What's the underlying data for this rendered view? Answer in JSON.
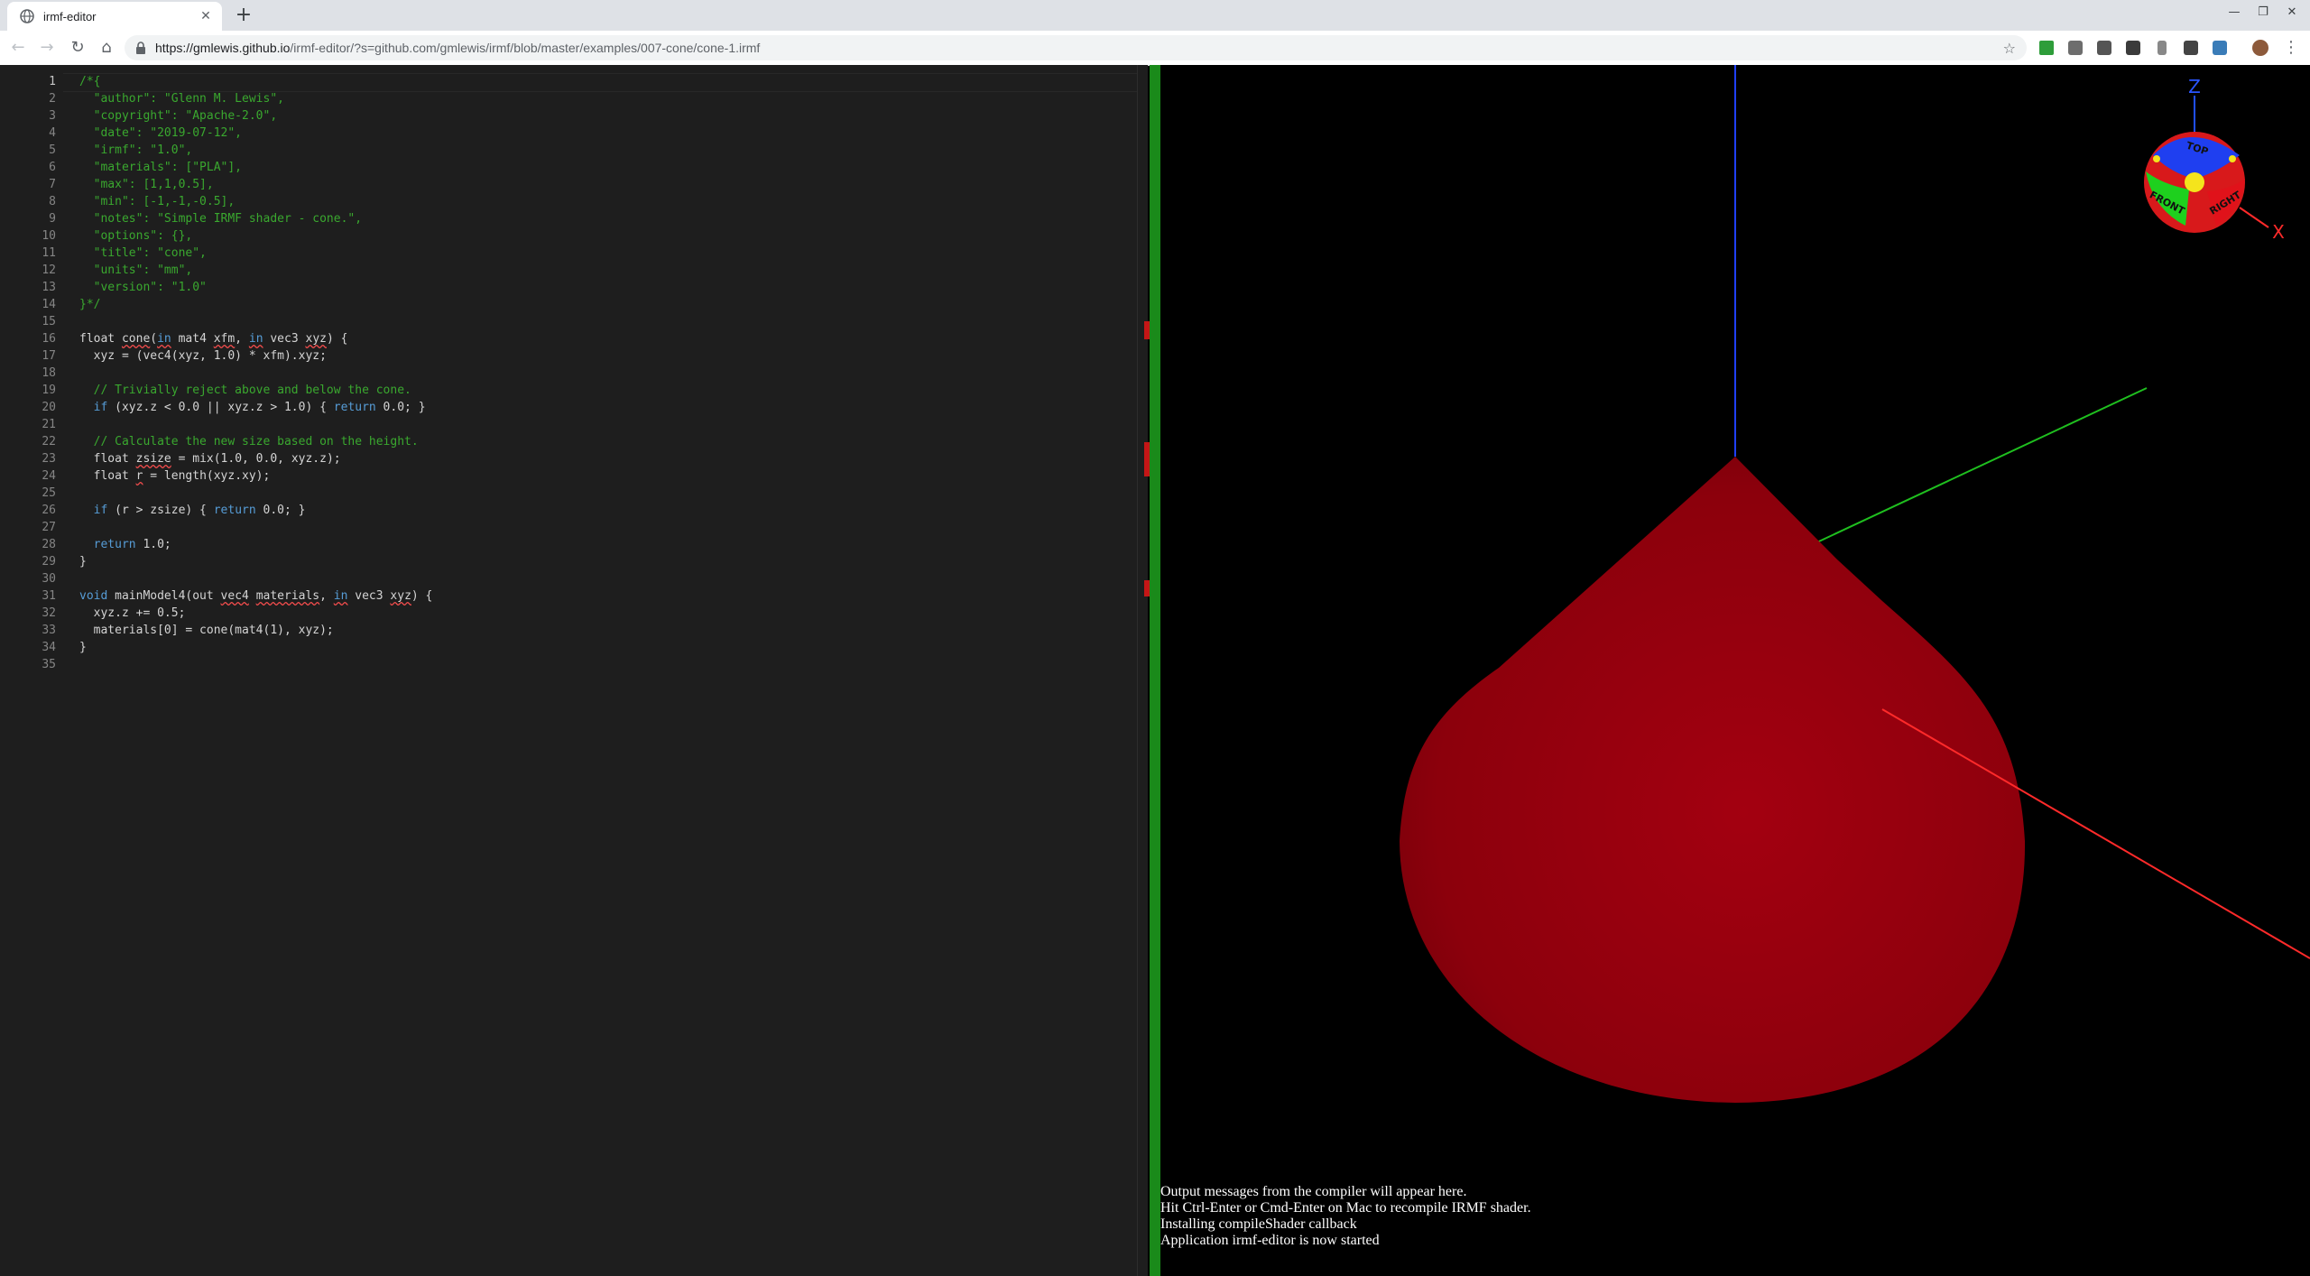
{
  "browser": {
    "tab_title": "irmf-editor",
    "url_host": "https://gmlewis.github.io",
    "url_rest": "/irmf-editor/?s=github.com/gmlewis/irmf/blob/master/examples/007-cone/cone-1.irmf"
  },
  "editor": {
    "lines": [
      {
        "n": "1",
        "html": "<span class=\"c-com\">/*{</span>"
      },
      {
        "n": "2",
        "html": "<span class=\"c-com\">  \"author\": \"Glenn M. Lewis\",</span>"
      },
      {
        "n": "3",
        "html": "<span class=\"c-com\">  \"copyright\": \"Apache-2.0\",</span>"
      },
      {
        "n": "4",
        "html": "<span class=\"c-com\">  \"date\": \"2019-07-12\",</span>"
      },
      {
        "n": "5",
        "html": "<span class=\"c-com\">  \"irmf\": \"1.0\",</span>"
      },
      {
        "n": "6",
        "html": "<span class=\"c-com\">  \"materials\": [\"PLA\"],</span>"
      },
      {
        "n": "7",
        "html": "<span class=\"c-com\">  \"max\": [1,1,0.5],</span>"
      },
      {
        "n": "8",
        "html": "<span class=\"c-com\">  \"min\": [-1,-1,-0.5],</span>"
      },
      {
        "n": "9",
        "html": "<span class=\"c-com\">  \"notes\": \"Simple IRMF shader - cone.\",</span>"
      },
      {
        "n": "10",
        "html": "<span class=\"c-com\">  \"options\": {},</span>"
      },
      {
        "n": "11",
        "html": "<span class=\"c-com\">  \"title\": \"cone\",</span>"
      },
      {
        "n": "12",
        "html": "<span class=\"c-com\">  \"units\": \"mm\",</span>"
      },
      {
        "n": "13",
        "html": "<span class=\"c-com\">  \"version\": \"1.0\"</span>"
      },
      {
        "n": "14",
        "html": "<span class=\"c-com\">}*/</span>"
      },
      {
        "n": "15",
        "html": ""
      },
      {
        "n": "16",
        "html": "float <span class=\"sq\">cone</span>(<span class=\"c-kw sq\">in</span> mat4 <span class=\"sq\">xfm</span>, <span class=\"c-kw sq\">in</span> vec3 <span class=\"sq\">xyz</span>) {"
      },
      {
        "n": "17",
        "html": "  xyz = (vec4(xyz, 1.0) * xfm).xyz;"
      },
      {
        "n": "18",
        "html": ""
      },
      {
        "n": "19",
        "html": "<span class=\"c-com\">  // Trivially reject above and below the cone.</span>"
      },
      {
        "n": "20",
        "html": "  <span class=\"c-kw\">if</span> (xyz.z &lt; 0.0 || xyz.z &gt; 1.0) { <span class=\"c-kw\">return</span> 0.0; }"
      },
      {
        "n": "21",
        "html": ""
      },
      {
        "n": "22",
        "html": "<span class=\"c-com\">  // Calculate the new size based on the height.</span>"
      },
      {
        "n": "23",
        "html": "  float <span class=\"sq\">zsize</span> = mix(1.0, 0.0, xyz.z);"
      },
      {
        "n": "24",
        "html": "  float <span class=\"sq\">r</span> = length(xyz.xy);"
      },
      {
        "n": "25",
        "html": ""
      },
      {
        "n": "26",
        "html": "  <span class=\"c-kw\">if</span> (r &gt; zsize) { <span class=\"c-kw\">return</span> 0.0; }"
      },
      {
        "n": "27",
        "html": ""
      },
      {
        "n": "28",
        "html": "  <span class=\"c-kw\">return</span> 1.0;"
      },
      {
        "n": "29",
        "html": "}"
      },
      {
        "n": "30",
        "html": ""
      },
      {
        "n": "31",
        "html": "<span class=\"c-kw\">void</span> mainModel4(out <span class=\"sq\">vec4</span> <span class=\"sq\">materials</span>, <span class=\"c-kw sq\">in</span> vec3 <span class=\"sq\">xyz</span>) {"
      },
      {
        "n": "32",
        "html": "  xyz.z += 0.5;"
      },
      {
        "n": "33",
        "html": "  materials[0] = cone(mat4(1), xyz);"
      },
      {
        "n": "34",
        "html": "}"
      },
      {
        "n": "35",
        "html": ""
      }
    ]
  },
  "viewport": {
    "axis_z_label": "Z",
    "axis_x_label": "X",
    "cube_labels": {
      "top": "TOP",
      "front": "FRONT",
      "right": "RIGHT"
    }
  },
  "output": {
    "lines": [
      "Output messages from the compiler will appear here.",
      "Hit Ctrl-Enter or Cmd-Enter on Mac to recompile IRMF shader.",
      "Installing compileShader callback",
      "Application irmf-editor is now started"
    ]
  }
}
